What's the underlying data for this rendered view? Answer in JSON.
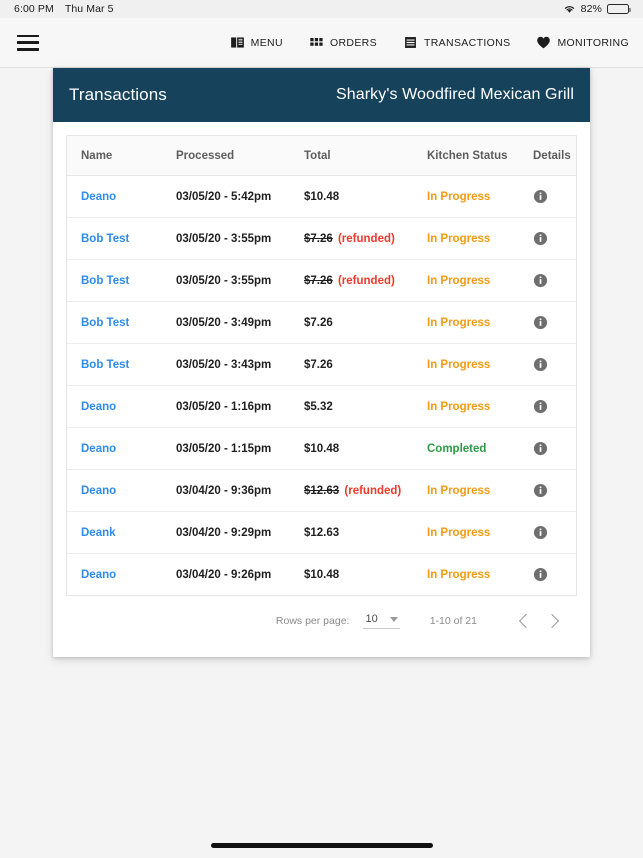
{
  "status_bar": {
    "time": "6:00 PM",
    "date": "Thu Mar 5",
    "wifi_icon": "wifi-icon",
    "battery_percent": "82%",
    "battery_level": 82,
    "battery_icon": "battery-icon"
  },
  "topnav": {
    "menu_toggle_icon": "hamburger-menu-icon",
    "items": [
      {
        "label": "MENU",
        "icon": "book-icon"
      },
      {
        "label": "ORDERS",
        "icon": "grid-apps-icon"
      },
      {
        "label": "TRANSACTIONS",
        "icon": "list-rows-icon"
      },
      {
        "label": "MONITORING",
        "icon": "heart-icon"
      }
    ]
  },
  "card": {
    "title": "Transactions",
    "restaurant": "Sharky's Woodfired Mexican Grill",
    "header_color": "#16425c"
  },
  "table": {
    "columns": [
      "Name",
      "Processed",
      "Total",
      "Kitchen Status",
      "Details"
    ],
    "details_icon": "info-icon",
    "rows": [
      {
        "name": "Deano",
        "processed": "03/05/20 - 5:42pm",
        "total": "$10.48",
        "refunded": false,
        "refund_label": "",
        "status": "In Progress",
        "status_type": "in-progress"
      },
      {
        "name": "Bob Test",
        "processed": "03/05/20 - 3:55pm",
        "total": "$7.26",
        "refunded": true,
        "refund_label": "(refunded)",
        "status": "In Progress",
        "status_type": "in-progress"
      },
      {
        "name": "Bob Test",
        "processed": "03/05/20 - 3:55pm",
        "total": "$7.26",
        "refunded": true,
        "refund_label": "(refunded)",
        "status": "In Progress",
        "status_type": "in-progress"
      },
      {
        "name": "Bob Test",
        "processed": "03/05/20 - 3:49pm",
        "total": "$7.26",
        "refunded": false,
        "refund_label": "",
        "status": "In Progress",
        "status_type": "in-progress"
      },
      {
        "name": "Bob Test",
        "processed": "03/05/20 - 3:43pm",
        "total": "$7.26",
        "refunded": false,
        "refund_label": "",
        "status": "In Progress",
        "status_type": "in-progress"
      },
      {
        "name": "Deano",
        "processed": "03/05/20 - 1:16pm",
        "total": "$5.32",
        "refunded": false,
        "refund_label": "",
        "status": "In Progress",
        "status_type": "in-progress"
      },
      {
        "name": "Deano",
        "processed": "03/05/20 - 1:15pm",
        "total": "$10.48",
        "refunded": false,
        "refund_label": "",
        "status": "Completed",
        "status_type": "completed"
      },
      {
        "name": "Deano",
        "processed": "03/04/20 - 9:36pm",
        "total": "$12.63",
        "refunded": true,
        "refund_label": "(refunded)",
        "status": "In Progress",
        "status_type": "in-progress"
      },
      {
        "name": "Deank",
        "processed": "03/04/20 - 9:29pm",
        "total": "$12.63",
        "refunded": false,
        "refund_label": "",
        "status": "In Progress",
        "status_type": "in-progress"
      },
      {
        "name": "Deano",
        "processed": "03/04/20 - 9:26pm",
        "total": "$10.48",
        "refunded": false,
        "refund_label": "",
        "status": "In Progress",
        "status_type": "in-progress"
      }
    ]
  },
  "pagination": {
    "rows_per_page_label": "Rows per page:",
    "rows_per_page_value": "10",
    "range_label": "1-10 of 21",
    "prev_icon": "chevron-left-icon",
    "next_icon": "chevron-right-icon"
  },
  "colors": {
    "link": "#2d8ceb",
    "in_progress": "#f59a11",
    "completed": "#2e9b45",
    "refunded": "#f0392b",
    "header_bg": "#16425c",
    "page_bg": "#f4f4f4"
  }
}
